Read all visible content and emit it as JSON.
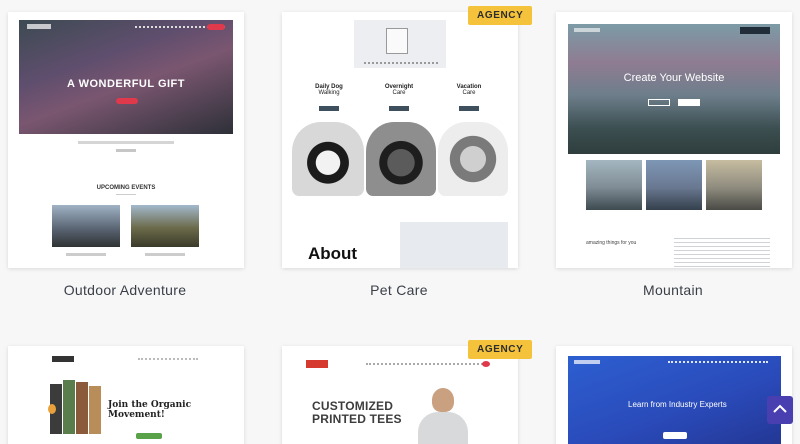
{
  "badge_label": "AGENCY",
  "templates": [
    {
      "name": "Outdoor Adventure",
      "hero_heading": "A WONDERFUL GIFT",
      "section_heading": "UPCOMING EVENTS"
    },
    {
      "name": "Pet Care",
      "services": [
        {
          "title": "Daily Dog",
          "subtitle": "Walking"
        },
        {
          "title": "Overnight",
          "subtitle": "Care"
        },
        {
          "title": "Vacation",
          "subtitle": "Care"
        }
      ],
      "about_heading": "About"
    },
    {
      "name": "Mountain",
      "hero_heading": "Create Your Website",
      "tagline": "amazing things for you"
    },
    {
      "name": "",
      "hero_heading": "Join the Organic Movement!"
    },
    {
      "name": "",
      "hero_heading": "CUSTOMIZED PRINTED TEES"
    },
    {
      "name": "",
      "hero_heading": "Learn from Industry Experts"
    }
  ],
  "colors": {
    "accent": "#e0394b",
    "badge": "#f5c33b",
    "scroll_button": "#4a3fb1"
  },
  "scroll_icon": "chevron-up-icon"
}
